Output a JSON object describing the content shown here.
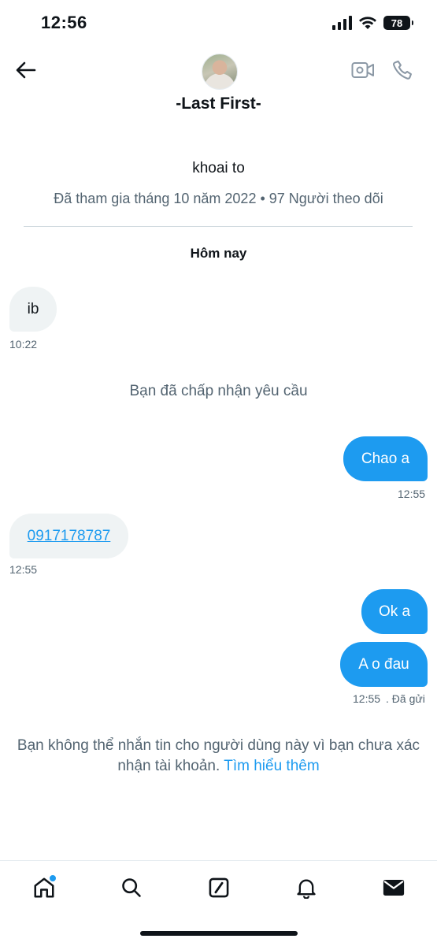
{
  "status_bar": {
    "time": "12:56",
    "battery": "78"
  },
  "header": {
    "display_name": "-Last First-"
  },
  "profile": {
    "handle": "khoai to",
    "meta": "Đã tham gia tháng 10 năm 2022 • 97 Người theo dõi"
  },
  "day_label": "Hôm nay",
  "messages": [
    {
      "direction": "in",
      "text": "ib",
      "time": "10:22"
    },
    {
      "direction": "system",
      "text": "Bạn đã chấp nhận yêu cầu"
    },
    {
      "direction": "out",
      "text": "Chao a",
      "time": "12:55"
    },
    {
      "direction": "in",
      "text": "0917178787",
      "time": "12:55"
    },
    {
      "direction": "out",
      "text": "Ok a"
    },
    {
      "direction": "out",
      "text": "A o đau",
      "time": "12:55",
      "status": ". Đã gửi"
    }
  ],
  "notice": {
    "text": "Bạn không thể nhắn tin cho người dùng này vì bạn chưa xác nhận tài khoản.",
    "link": "Tìm hiểu thêm"
  },
  "colors": {
    "accent": "#1d9bf0",
    "incoming_bubble": "#eff3f4",
    "secondary_text": "#536471"
  },
  "nav": {
    "items": [
      "home-icon",
      "search-icon",
      "compose-icon",
      "notifications-icon",
      "messages-icon"
    ]
  }
}
